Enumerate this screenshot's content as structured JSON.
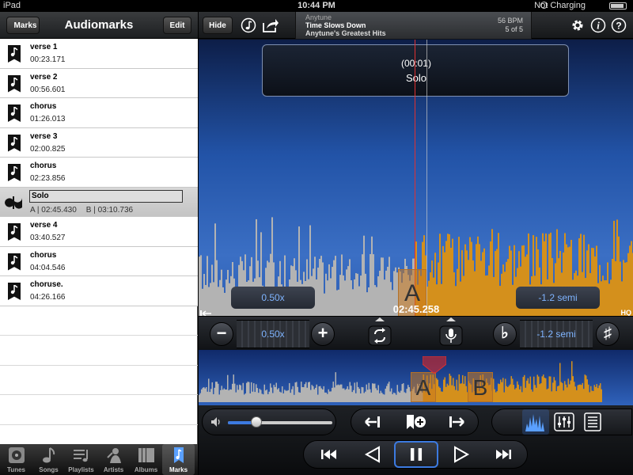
{
  "status_bar": {
    "carrier": "iPad",
    "time": "10:44 PM",
    "battery_text": "Not Charging"
  },
  "left_panel": {
    "back_label": "Marks",
    "title": "Audiomarks",
    "edit_label": "Edit",
    "marks": [
      {
        "name": "verse 1",
        "time": "00:23.171"
      },
      {
        "name": "verse 2",
        "time": "00:56.601"
      },
      {
        "name": "chorus",
        "time": "01:26.013"
      },
      {
        "name": "verse 3",
        "time": "02:00.825"
      },
      {
        "name": "chorus",
        "time": "02:23.856"
      },
      {
        "name": "Solo",
        "a_label": "A | 02:45.430",
        "b_label": "B | 03:10.736"
      },
      {
        "name": "verse 4",
        "time": "03:40.527"
      },
      {
        "name": "chorus",
        "time": "04:04.546"
      },
      {
        "name": "choruse.",
        "time": "04:26.166"
      }
    ]
  },
  "tab_bar": {
    "tabs": [
      {
        "label": "Tunes",
        "icon": "tunes-icon"
      },
      {
        "label": "Songs",
        "icon": "note-icon"
      },
      {
        "label": "Playlists",
        "icon": "playlist-icon"
      },
      {
        "label": "Artists",
        "icon": "artist-icon"
      },
      {
        "label": "Albums",
        "icon": "album-icon"
      },
      {
        "label": "Marks",
        "icon": "bookmark-icon"
      }
    ],
    "active": "Marks"
  },
  "top_bar": {
    "hide_label": "Hide",
    "app_name": "Anytune",
    "song_title": "Time Slows Down",
    "album": "Anytune's Greatest Hits",
    "bpm": "56 BPM",
    "position": "5 of 5"
  },
  "waveform": {
    "callout_time": "(00:01)",
    "callout_name": "Solo",
    "current_time": "02:45.258",
    "marker_a": "A",
    "marker_b": "B",
    "hq_label": "HQ"
  },
  "speed": {
    "value": "0.50x",
    "minus": "−",
    "plus": "+"
  },
  "pitch": {
    "value": "-1.2 semi",
    "flat": "♭",
    "sharp": "♯"
  },
  "volume": {
    "level": 0.27
  },
  "colors": {
    "accent": "#3c7ae0",
    "wave_gray": "#b3b3b3",
    "wave_orange": "#d4901c",
    "bg_blue": "#2a5ab0"
  }
}
